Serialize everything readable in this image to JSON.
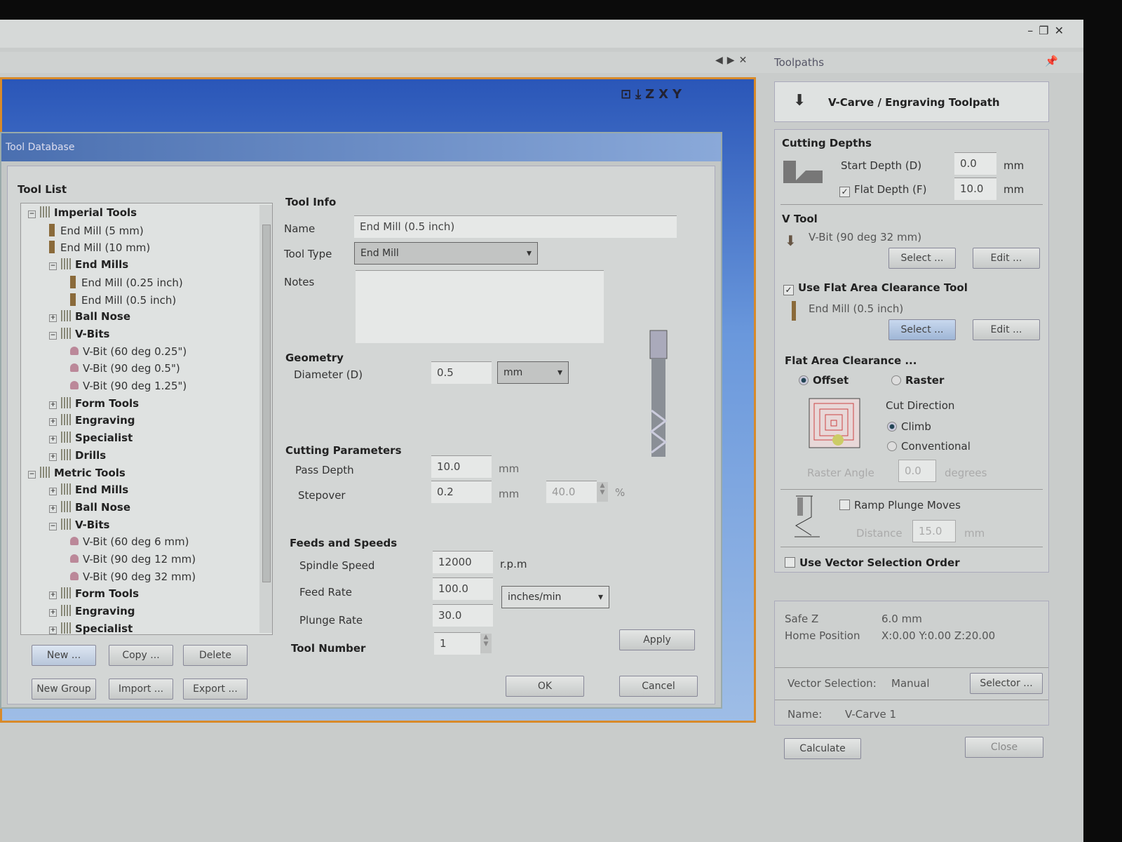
{
  "window": {
    "controls": [
      "–",
      "❐",
      "✕"
    ],
    "dock_controls": [
      "◀",
      "▶",
      "✕"
    ]
  },
  "viewport": {
    "tools": [
      "⊡",
      "⤓",
      "Z",
      "X",
      "Y"
    ]
  },
  "tool_database": {
    "title": "Tool Database",
    "tool_list_label": "Tool List",
    "tree": [
      {
        "label": "Imperial Tools",
        "level": 0,
        "group": true,
        "expander": "−"
      },
      {
        "label": "End Mill (5 mm)",
        "level": 1,
        "type": "bit"
      },
      {
        "label": "End Mill (10 mm)",
        "level": 1,
        "type": "bit"
      },
      {
        "label": "End Mills",
        "level": 1,
        "group": true,
        "expander": "−"
      },
      {
        "label": "End Mill (0.25 inch)",
        "level": 2,
        "type": "bit"
      },
      {
        "label": "End Mill (0.5 inch)",
        "level": 2,
        "type": "bit"
      },
      {
        "label": "Ball Nose",
        "level": 1,
        "group": true,
        "expander": "+"
      },
      {
        "label": "V-Bits",
        "level": 1,
        "group": true,
        "expander": "−"
      },
      {
        "label": "V-Bit (60 deg 0.25\")",
        "level": 2,
        "type": "vbit"
      },
      {
        "label": "V-Bit (90 deg 0.5\")",
        "level": 2,
        "type": "vbit"
      },
      {
        "label": "V-Bit (90 deg 1.25\")",
        "level": 2,
        "type": "vbit"
      },
      {
        "label": "Form Tools",
        "level": 1,
        "group": true,
        "expander": "+"
      },
      {
        "label": "Engraving",
        "level": 1,
        "group": true,
        "expander": "+"
      },
      {
        "label": "Specialist",
        "level": 1,
        "group": true,
        "expander": "+"
      },
      {
        "label": "Drills",
        "level": 1,
        "group": true,
        "expander": "+"
      },
      {
        "label": "Metric Tools",
        "level": 0,
        "group": true,
        "expander": "−"
      },
      {
        "label": "End Mills",
        "level": 1,
        "group": true,
        "expander": "+"
      },
      {
        "label": "Ball Nose",
        "level": 1,
        "group": true,
        "expander": "+"
      },
      {
        "label": "V-Bits",
        "level": 1,
        "group": true,
        "expander": "−"
      },
      {
        "label": "V-Bit (60 deg 6 mm)",
        "level": 2,
        "type": "vbit"
      },
      {
        "label": "V-Bit (90 deg 12 mm)",
        "level": 2,
        "type": "vbit"
      },
      {
        "label": "V-Bit (90 deg 32 mm)",
        "level": 2,
        "type": "vbit"
      },
      {
        "label": "Form Tools",
        "level": 1,
        "group": true,
        "expander": "+"
      },
      {
        "label": "Engraving",
        "level": 1,
        "group": true,
        "expander": "+"
      },
      {
        "label": "Specialist",
        "level": 1,
        "group": true,
        "expander": "+"
      }
    ],
    "list_buttons": {
      "new": "New ...",
      "copy": "Copy ...",
      "delete": "Delete",
      "new_group": "New Group",
      "import": "Import ...",
      "export": "Export ..."
    },
    "tool_info": {
      "heading": "Tool Info",
      "name_label": "Name",
      "name_value": "End Mill (0.5 inch)",
      "type_label": "Tool Type",
      "type_value": "End Mill",
      "notes_label": "Notes",
      "notes_value": ""
    },
    "geometry": {
      "heading": "Geometry",
      "diameter_label": "Diameter (D)",
      "diameter_value": "0.5",
      "units": "mm"
    },
    "cutting": {
      "heading": "Cutting Parameters",
      "pass_depth_label": "Pass Depth",
      "pass_depth_value": "10.0",
      "pass_depth_unit": "mm",
      "stepover_label": "Stepover",
      "stepover_value": "0.2",
      "stepover_unit": "mm",
      "stepover_pct": "40.0",
      "pct": "%"
    },
    "feeds": {
      "heading": "Feeds and Speeds",
      "spindle_label": "Spindle Speed",
      "spindle_value": "12000",
      "spindle_unit": "r.p.m",
      "feed_label": "Feed Rate",
      "feed_value": "100.0",
      "plunge_label": "Plunge Rate",
      "plunge_value": "30.0",
      "rate_units": "inches/min"
    },
    "tool_number": {
      "label": "Tool Number",
      "value": "1"
    },
    "apply": "Apply",
    "ok": "OK",
    "cancel": "Cancel"
  },
  "toolpaths": {
    "panel_title": "Toolpaths",
    "header": "V-Carve / Engraving Toolpath",
    "cutting_depths": {
      "heading": "Cutting Depths",
      "start_label": "Start Depth (D)",
      "start_value": "0.0",
      "flat_label": "Flat Depth (F)",
      "flat_value": "10.0",
      "flat_checked": true,
      "unit": "mm"
    },
    "v_tool": {
      "heading": "V Tool",
      "tool": "V-Bit (90 deg 32 mm)",
      "select": "Select ...",
      "edit": "Edit ..."
    },
    "flat_tool": {
      "label": "Use Flat Area Clearance Tool",
      "checked": true,
      "tool": "End Mill (0.5 inch)",
      "select": "Select ...",
      "edit": "Edit ..."
    },
    "clearance": {
      "heading": "Flat Area Clearance ...",
      "offset": "Offset",
      "raster": "Raster",
      "selected": "Offset",
      "cut_direction": "Cut Direction",
      "climb": "Climb",
      "conventional": "Conventional",
      "direction": "Climb",
      "raster_angle_label": "Raster Angle",
      "raster_angle_value": "0.0",
      "raster_angle_unit": "degrees"
    },
    "ramp": {
      "label": "Ramp Plunge Moves",
      "checked": false,
      "distance_label": "Distance",
      "distance_value": "15.0",
      "unit": "mm"
    },
    "vector_order": {
      "label": "Use Vector Selection Order",
      "checked": false
    },
    "safe_z_label": "Safe Z",
    "safe_z_value": "6.0 mm",
    "home_label": "Home Position",
    "home_value": "X:0.00 Y:0.00 Z:20.00",
    "vector_selection_label": "Vector Selection:",
    "vector_selection_value": "Manual",
    "selector": "Selector ...",
    "name_label": "Name:",
    "name_value": "V-Carve 1",
    "calculate": "Calculate",
    "close": "Close"
  },
  "colors": {
    "viewport_blue": "#2a56b8",
    "viewport_border": "#d88a2a",
    "selected_button": "#a8c0e0"
  }
}
